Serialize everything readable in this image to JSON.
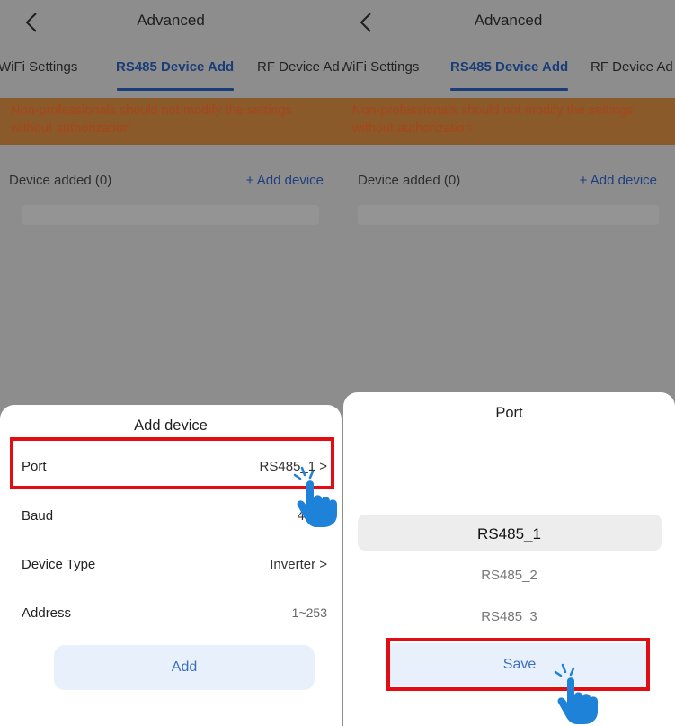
{
  "left": {
    "header": {
      "title": "Advanced"
    },
    "tabs": [
      "WiFi Settings",
      "RS485 Device Add",
      "RF Device Ad"
    ],
    "warning": [
      "Non-professionals should not modify the settings",
      "without authorization"
    ],
    "devices": {
      "label": "Device added (0)",
      "add_link": "+ Add device"
    },
    "sheet": {
      "title": "Add device",
      "rows": [
        {
          "label": "Port",
          "value": "RS485_1 >"
        },
        {
          "label": "Baud",
          "value": "4800"
        },
        {
          "label": "Device Type",
          "value": "Inverter >"
        },
        {
          "label": "Address",
          "value": "1~253"
        }
      ],
      "button": "Add"
    }
  },
  "right": {
    "header": {
      "title": "Advanced"
    },
    "tabs": [
      "WiFi Settings",
      "RS485 Device Add",
      "RF Device Ad"
    ],
    "warning": [
      "Non-professionals should not modify the settings",
      "without authorization"
    ],
    "devices": {
      "label": "Device added (0)",
      "add_link": "+ Add device"
    },
    "sheet": {
      "title": "Port",
      "options": [
        "RS485_1",
        "RS485_2",
        "RS485_3"
      ],
      "selected": "RS485_1",
      "button": "Save"
    }
  },
  "icons": {
    "back": "chevron-left-icon",
    "pointer": "tap-hand-icon"
  },
  "colors": {
    "accent": "#1a3d78",
    "highlight": "#e20d13",
    "warning_bg": "#8b5a2a",
    "button_bg": "#e8f0fb"
  }
}
